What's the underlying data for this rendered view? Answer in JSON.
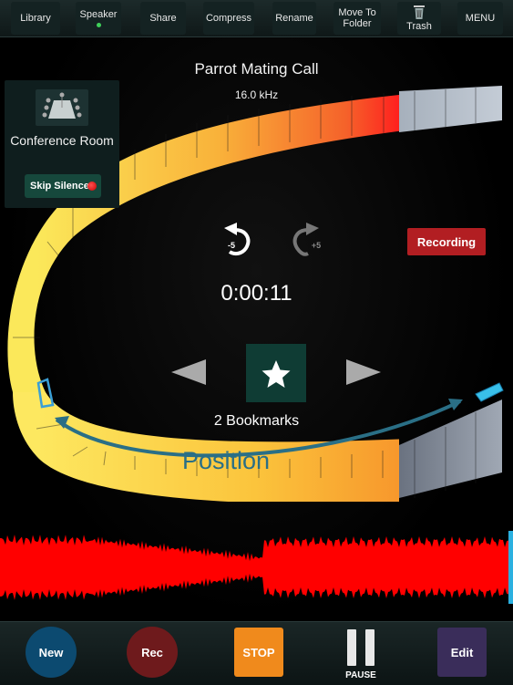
{
  "toolbar": {
    "library": "Library",
    "speaker": "Speaker",
    "share": "Share",
    "compress": "Compress",
    "rename": "Rename",
    "move_to_folder_line1": "Move To",
    "move_to_folder_line2": "Folder",
    "trash": "Trash",
    "menu": "MENU"
  },
  "recording": {
    "title": "Parrot Mating Call",
    "frequency": "16.0 kHz",
    "time": "0:00:11",
    "bookmarks": "2 Bookmarks",
    "status_button": "Recording",
    "position_label": "Position",
    "level_fraction": 0.79
  },
  "room": {
    "label": "Conference Room",
    "skip_silence": "Skip Silence"
  },
  "skip": {
    "back": "-5",
    "forward": "+5"
  },
  "bottom": {
    "new": "New",
    "rec": "Rec",
    "stop": "STOP",
    "pause": "PAUSE",
    "edit": "Edit"
  },
  "colors": {
    "new_button": "#0c4a70",
    "rec_button": "#6e1a1c",
    "stop_button": "#f08a1c",
    "edit_button": "#3a2d5a",
    "recording_button": "#b21e22",
    "waveform": "#ff0000",
    "accent": "#2a6f86"
  }
}
